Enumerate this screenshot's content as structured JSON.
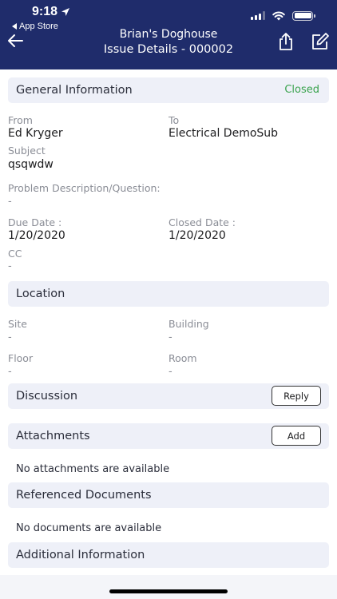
{
  "status_bar": {
    "time": "9:18",
    "back_app": "App Store"
  },
  "header": {
    "project": "Brian's Doghouse",
    "title": "Issue Details - 000002"
  },
  "general": {
    "title": "General Information",
    "status": "Closed",
    "status_color": "#3aa34e",
    "from_label": "From",
    "from_value": "Ed Kryger",
    "to_label": "To",
    "to_value": "Electrical DemoSub",
    "subject_label": "Subject",
    "subject_value": "qsqwdw",
    "problem_label": "Problem Description/Question:",
    "problem_value": "-",
    "due_label": "Due Date :",
    "due_value": "1/20/2020",
    "closed_label": "Closed Date :",
    "closed_value": "1/20/2020",
    "cc_label": "CC",
    "cc_value": "-"
  },
  "location": {
    "title": "Location",
    "site_label": "Site",
    "site_value": "-",
    "building_label": "Building",
    "building_value": "-",
    "floor_label": "Floor",
    "floor_value": "-",
    "room_label": "Room",
    "room_value": "-"
  },
  "discussion": {
    "title": "Discussion",
    "reply_label": "Reply"
  },
  "attachments": {
    "title": "Attachments",
    "add_label": "Add",
    "empty": "No attachments are available"
  },
  "referenced": {
    "title": "Referenced Documents",
    "empty": "No documents are available"
  },
  "additional": {
    "title": "Additional Information"
  },
  "colors": {
    "header_bg": "#1f2c6b",
    "section_bg": "#eef0f8"
  }
}
